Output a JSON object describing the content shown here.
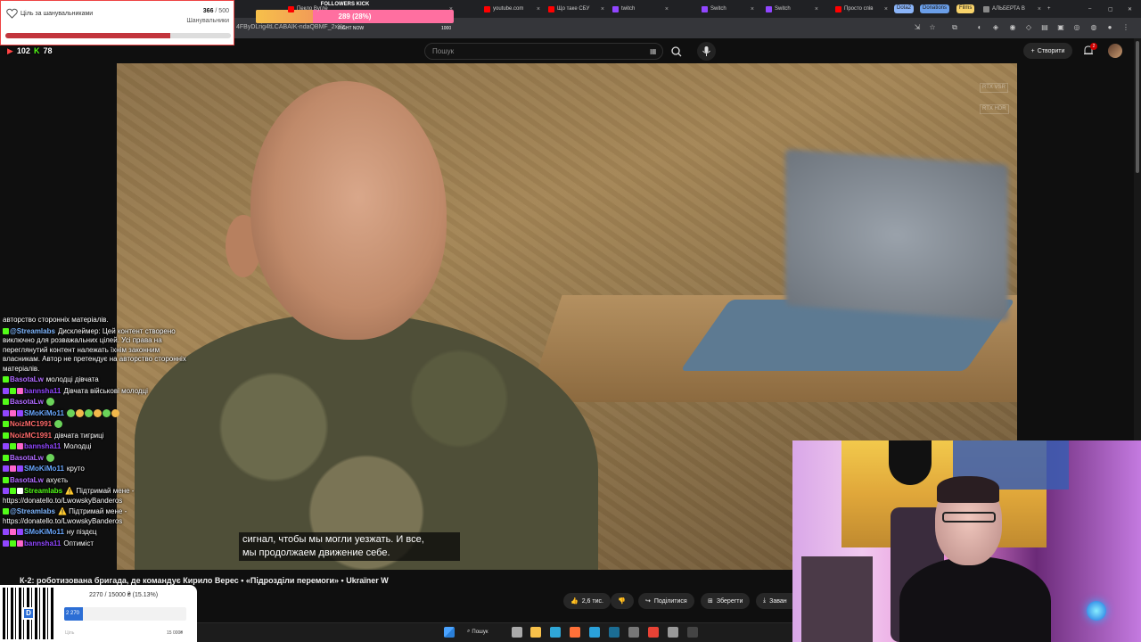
{
  "browser": {
    "tabs": [
      {
        "label": "FOLLOWERS KICK",
        "color": "#cc3333"
      },
      {
        "label": "Пекло Вугле",
        "color": "#ff0000"
      },
      {
        "label": "youtube.com",
        "color": "#ff0000"
      },
      {
        "label": "Що таке СБУ",
        "color": "#ff0000"
      },
      {
        "label": "twitch",
        "color": "#9146ff"
      },
      {
        "label": "Switch",
        "color": "#9146ff"
      },
      {
        "label": "Switch",
        "color": "#9146ff"
      },
      {
        "label": "Просто спів",
        "color": "#ff0000"
      },
      {
        "label": "АЛЬБЕРТА В",
        "color": "#888888"
      }
    ],
    "tab_groups": [
      {
        "label": "Dota2",
        "color": "#8ab4f8"
      },
      {
        "label": "Donations",
        "color": "#6a9ee8"
      },
      {
        "label": "Films",
        "color": "#f8d36a"
      }
    ],
    "url": "4FByDLrig4tLCABAIK-ndaQBMF_2xYz"
  },
  "youtube": {
    "search_placeholder": "Пошук",
    "create_label": "Створити",
    "notification_count": "2",
    "subtitle_line1": "сигнал, чтобы мы могли уезжать. И все,",
    "subtitle_line2": "мы продолжаем движение себе.",
    "video_title": "К-2: роботизована бригада, де командує Кирило Верес • «Підрозділи перемоги» • Ukraïner W",
    "likes": "2,6 тис.",
    "share_label": "Поділитися",
    "save_label": "Зберегти",
    "download_label": "Заван",
    "rtx_labels": [
      "RTX VSR",
      "RTX HDR"
    ]
  },
  "overlays": {
    "fan_goal": {
      "title": "Ціль за шанувальниками",
      "current": "366",
      "target": "/ 500",
      "unit": "Шанувальники",
      "progress": 0.732
    },
    "kick": {
      "label": "FOLLOWERS KICK",
      "value_text": "289 (28%)",
      "progress": 0.289,
      "right_now": "RIGHT NOW",
      "max": "1000"
    },
    "counters": {
      "youtube": "102",
      "kick": "78"
    },
    "donation": {
      "amount_text": "2270 / 15000 ₴ (15.13%)",
      "bar_label": "2 270",
      "progress": 0.1513,
      "min_label": "Ціль",
      "max_label": "15 000₴"
    }
  },
  "chat": [
    {
      "user": "",
      "text": "авторство сторонніх матеріалів.",
      "color": "#ffffff",
      "badges": []
    },
    {
      "user": "@Streamlabs",
      "text": "Дисклеймер: Цей контент створено виключно для розважальних цілей. Усі права на переглянутий контент належать їхнім законним власникам. Автор не претендує на авторство сторонніх матеріалів.",
      "color": "#7fb7ff",
      "badges": [
        "#53fc18"
      ]
    },
    {
      "user": "BasotaLw",
      "text": "молодці дівчата",
      "color": "#b06aff",
      "badges": [
        "#53fc18"
      ]
    },
    {
      "user": "bannsha11",
      "text": "Дівчата військові молодці",
      "color": "#9146ff",
      "badges": [
        "#9146ff",
        "#53fc18",
        "#ff66cc"
      ]
    },
    {
      "user": "BasotaLw",
      "text": "",
      "color": "#b06aff",
      "badges": [
        "#53fc18"
      ],
      "emotes": 1
    },
    {
      "user": "SMoKiMo11",
      "text": "",
      "color": "#6aa8ff",
      "badges": [
        "#9146ff",
        "#ff66cc",
        "#9146ff"
      ],
      "emotes": 6
    },
    {
      "user": "NoizMC1991",
      "text": "",
      "color": "#ff6a6a",
      "badges": [
        "#53fc18"
      ],
      "emotes": 1
    },
    {
      "user": "NoizMC1991",
      "text": "дівчата тигриці",
      "color": "#ff6a6a",
      "badges": [
        "#53fc18"
      ]
    },
    {
      "user": "bannsha11",
      "text": "Молодці",
      "color": "#9146ff",
      "badges": [
        "#9146ff",
        "#53fc18",
        "#ff66cc"
      ]
    },
    {
      "user": "BasotaLw",
      "text": "",
      "color": "#b06aff",
      "badges": [
        "#53fc18"
      ],
      "emotes": 1
    },
    {
      "user": "SMoKiMo11",
      "text": "круто",
      "color": "#6aa8ff",
      "badges": [
        "#9146ff",
        "#ff66cc",
        "#9146ff"
      ]
    },
    {
      "user": "BasotaLw",
      "text": "ахуєть",
      "color": "#b06aff",
      "badges": [
        "#53fc18"
      ]
    },
    {
      "user": "Streamlabs",
      "text": "⚠️ Підтримай мене - https://donatello.to/LwowskyBanderos",
      "color": "#53fc18",
      "badges": [
        "#9146ff",
        "#53fc18",
        "#ffffff"
      ]
    },
    {
      "user": "@Streamlabs",
      "text": "⚠️ Підтримай мене - https://donatello.to/LwowskyBanderos",
      "color": "#7fb7ff",
      "badges": [
        "#53fc18"
      ]
    },
    {
      "user": "SMoKiMo11",
      "text": "ну піздєц",
      "color": "#6aa8ff",
      "badges": [
        "#9146ff",
        "#ff66cc",
        "#9146ff"
      ]
    },
    {
      "user": "bannsha11",
      "text": "Оптиміст",
      "color": "#9146ff",
      "badges": [
        "#9146ff",
        "#53fc18",
        "#ff66cc"
      ]
    }
  ],
  "taskbar": {
    "search_label": "Пошук",
    "icons": [
      {
        "name": "start-icon",
        "color": "#4aa3ff"
      },
      {
        "name": "task-view-icon",
        "color": "#aaaaaa"
      },
      {
        "name": "file-explorer-icon",
        "color": "#f8c14a"
      },
      {
        "name": "edge-icon",
        "color": "#2fa7d8"
      },
      {
        "name": "firefox-icon",
        "color": "#ff7139"
      },
      {
        "name": "telegram-icon",
        "color": "#2aa1da"
      },
      {
        "name": "steam-icon",
        "color": "#1b6d94"
      },
      {
        "name": "calculator-icon",
        "color": "#777777"
      },
      {
        "name": "chrome-icon",
        "color": "#e94235"
      },
      {
        "name": "settings-icon",
        "color": "#999999"
      },
      {
        "name": "obs-icon",
        "color": "#444444"
      }
    ]
  }
}
